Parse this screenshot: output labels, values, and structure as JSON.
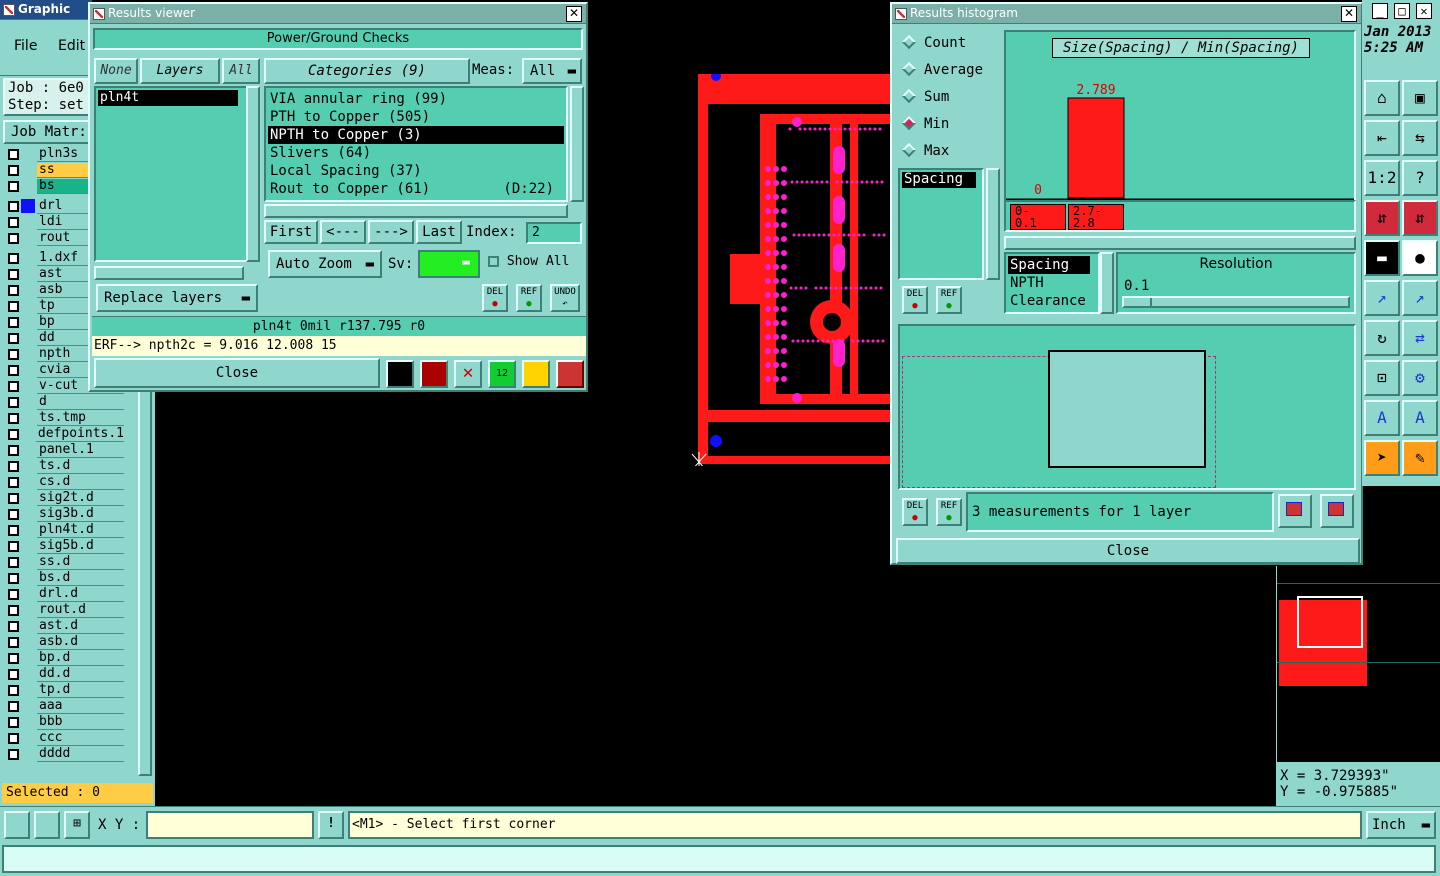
{
  "main": {
    "title": "Graphic Edit",
    "menu": [
      "File",
      "Edit"
    ],
    "job": "Job : 6e0",
    "step": "Step: set",
    "job_matrix": "Job Matr:",
    "selected": "Selected : 0",
    "xy_label": "X Y :",
    "prompt": "<M1> - Select first corner",
    "units": "Inch",
    "date": "Jan 2013",
    "time": "5:25 AM",
    "coord_x": "X = 3.729393\"",
    "coord_y": "Y = -0.975885\""
  },
  "layers": [
    "pln3s",
    "ss",
    "bs",
    "drl",
    "ldi",
    "rout",
    "1.dxf",
    "ast",
    "asb",
    "tp",
    "bp",
    "dd",
    "npth",
    "cvia",
    "v-cut",
    "d",
    "ts.tmp",
    "defpoints.1",
    "panel.1",
    "ts.d",
    "cs.d",
    "sig2t.d",
    "sig3b.d",
    "pln4t.d",
    "sig5b.d",
    "ss.d",
    "bs.d",
    "drl.d",
    "rout.d",
    "ast.d",
    "asb.d",
    "bp.d",
    "dd.d",
    "tp.d",
    "aaa",
    "bbb",
    "ccc",
    "dddd"
  ],
  "results_viewer": {
    "title": "Results viewer",
    "header": "Power/Ground Checks",
    "btn_none": "None",
    "btn_layers": "Layers",
    "btn_all": "All",
    "categories_label": "Categories (9)",
    "meas_label": "Meas:",
    "meas_value": "All",
    "layer_items": [
      "pln4t"
    ],
    "categories": [
      {
        "name": "VIA annular ring (99)",
        "extra": ""
      },
      {
        "name": "PTH to Copper (505)",
        "extra": ""
      },
      {
        "name": "NPTH to Copper (3)",
        "extra": ""
      },
      {
        "name": "Slivers (64)",
        "extra": ""
      },
      {
        "name": "Local Spacing (37)",
        "extra": ""
      },
      {
        "name": "Rout to Copper (61)",
        "extra": "(D:22)"
      }
    ],
    "nav": {
      "first": "First",
      "prev": "<---",
      "next": "--->",
      "last": "Last",
      "index_label": "Index:",
      "index_value": "2"
    },
    "auto_zoom": "Auto Zoom",
    "sv_label": "Sv:",
    "show_all": "Show All",
    "replace_layers": "Replace layers",
    "del": "DEL",
    "ref": "REF",
    "undo": "UNDO",
    "status1": "pln4t 0mil r137.795 r0",
    "status2": "ERF--> npth2c = 9.016 12.008 15",
    "close": "Close"
  },
  "histogram": {
    "title": "Results histogram",
    "modes": [
      "Count",
      "Average",
      "Sum",
      "Min",
      "Max"
    ],
    "selected_mode": "Min",
    "chart_title": "Size(Spacing) / Min(Spacing)",
    "list_item": "Spacing",
    "bins": [
      {
        "label": "0-\n0.1",
        "value": 0
      },
      {
        "label": "2.7-\n2.8",
        "value": 2.789
      }
    ],
    "attrs": [
      "Spacing",
      "NPTH",
      "Clearance"
    ],
    "resolution_label": "Resolution",
    "resolution_value": "0.1",
    "measurements": "3 measurements for 1 layer",
    "del": "DEL",
    "ref": "REF",
    "close": "Close"
  },
  "colors": {
    "teal": "#55cdb0",
    "pale": "#8fd6cc",
    "red": "#ff1a1a",
    "magenta": "#ff22cc",
    "blue": "#1010ff"
  }
}
